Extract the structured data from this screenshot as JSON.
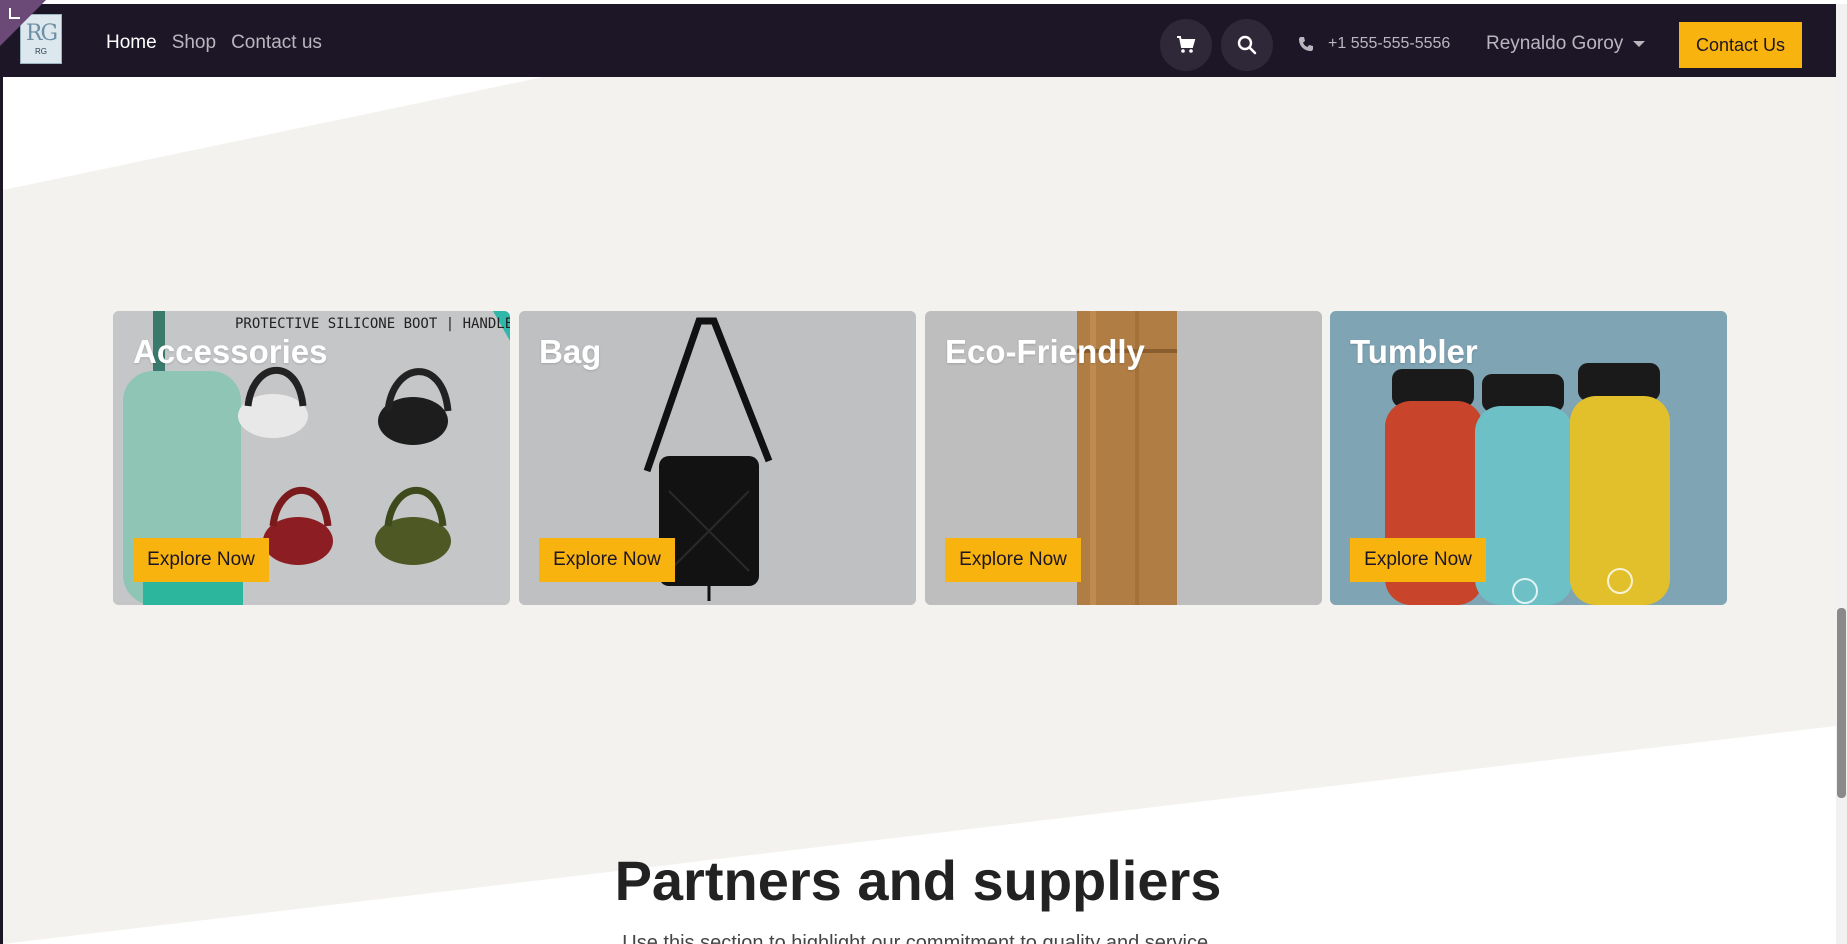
{
  "colors": {
    "navbar_bg": "#1c1626",
    "accent": "#f9b30f",
    "section_bg": "#f3f2ef"
  },
  "logo": {
    "monogram": "RG",
    "small_text": "RG"
  },
  "nav": {
    "links": [
      "Home",
      "Shop",
      "Contact us"
    ],
    "active": "Home",
    "cart_icon": "cart-icon",
    "search_icon": "search-icon",
    "phone_icon": "phone-icon",
    "phone": "+1 555-555-5556",
    "user_name": "Reynaldo Goroy",
    "contact_button": "Contact Us"
  },
  "categories": {
    "cards": [
      {
        "title": "Accessories",
        "button": "Explore Now",
        "image_text": "PROTECTIVE SILICONE BOOT | HANDLE"
      },
      {
        "title": "Bag",
        "button": "Explore Now"
      },
      {
        "title": "Eco-Friendly",
        "button": "Explore Now"
      },
      {
        "title": "Tumbler",
        "button": "Explore Now"
      }
    ]
  },
  "partners": {
    "title": "Partners and suppliers",
    "subtitle": "Use this section to highlight our commitment to quality and service."
  }
}
